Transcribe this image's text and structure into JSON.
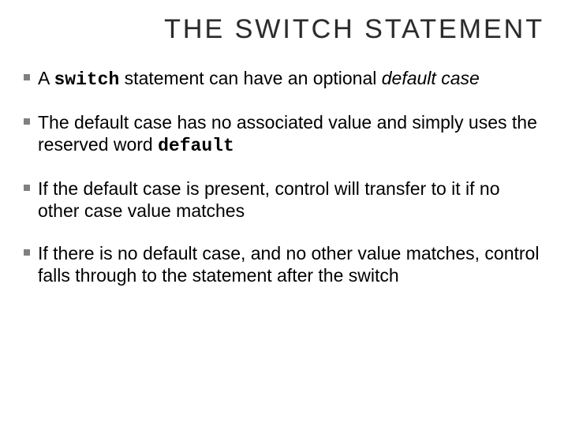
{
  "title": "THE SWITCH STATEMENT",
  "b1": {
    "t1": "A ",
    "code": "switch",
    "t2": " statement can have an optional ",
    "it1": "default case"
  },
  "b2": {
    "t1": "The default case has no associated value and simply uses the reserved word ",
    "code": "default"
  },
  "b3": {
    "t1": "If the default case is present, control will transfer to it if no other case value matches"
  },
  "b4": {
    "t1": "If there is no default case, and no other value matches, control falls through to the statement after the switch"
  }
}
